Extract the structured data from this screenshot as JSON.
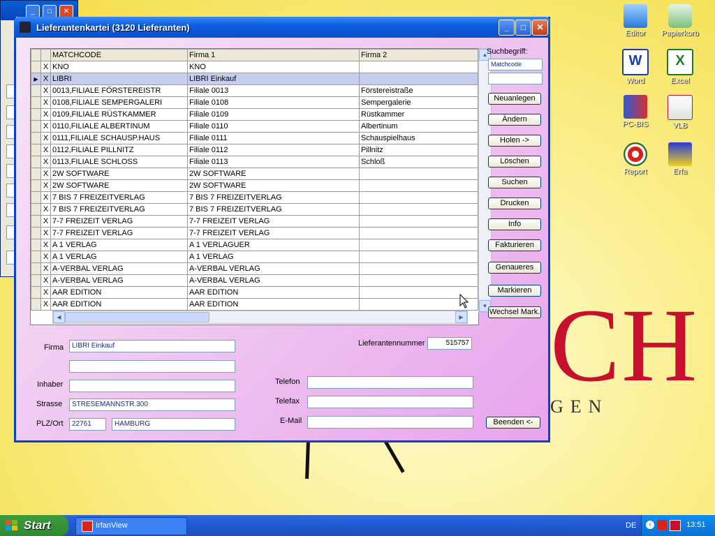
{
  "window": {
    "title": "Lieferantenkartei (3120 Lieferanten)"
  },
  "grid": {
    "columns": [
      "MATCHCODE",
      "Firma 1",
      "Firma 2"
    ],
    "rows": [
      {
        "check": "X",
        "matchcode": "KNO",
        "firma1": "KNO",
        "firma2": ""
      },
      {
        "check": "X",
        "matchcode": "LIBRI",
        "firma1": "LIBRI Einkauf",
        "firma2": ""
      },
      {
        "check": "X",
        "matchcode": "0013,FILIALE FÖRSTEREISTR",
        "firma1": "Filiale 0013",
        "firma2": "Förstereistraße"
      },
      {
        "check": "X",
        "matchcode": "0108,FILIALE SEMPERGALERI",
        "firma1": "Filiale 0108",
        "firma2": "Sempergalerie"
      },
      {
        "check": "X",
        "matchcode": "0109,FILIALE RÜSTKAMMER",
        "firma1": "Filiale 0109",
        "firma2": "Rüstkammer"
      },
      {
        "check": "X",
        "matchcode": "0110,FILIALE ALBERTINUM",
        "firma1": "Filiale 0110",
        "firma2": "Albertinum"
      },
      {
        "check": "X",
        "matchcode": "0111,FILIALE SCHAUSP.HAUS",
        "firma1": "Filiale 0111",
        "firma2": "Schauspielhaus"
      },
      {
        "check": "X",
        "matchcode": "0112,FILIALE PILLNITZ",
        "firma1": "Filiale 0112",
        "firma2": "Pillnitz"
      },
      {
        "check": "X",
        "matchcode": "0113,FILIALE SCHLOSS",
        "firma1": "Filiale 0113",
        "firma2": "Schloß"
      },
      {
        "check": "X",
        "matchcode": "2W SOFTWARE",
        "firma1": "2W SOFTWARE",
        "firma2": ""
      },
      {
        "check": "X",
        "matchcode": "2W SOFTWARE",
        "firma1": "2W SOFTWARE",
        "firma2": ""
      },
      {
        "check": "X",
        "matchcode": "7 BIS 7 FREIZEITVERLAG",
        "firma1": "7 BIS 7 FREIZEITVERLAG",
        "firma2": ""
      },
      {
        "check": "X",
        "matchcode": "7 BIS 7 FREIZEITVERLAG",
        "firma1": "7 BIS 7 FREIZEITVERLAG",
        "firma2": ""
      },
      {
        "check": "X",
        "matchcode": "7-7 FREIZEIT VERLAG",
        "firma1": "7-7 FREIZEIT VERLAG",
        "firma2": ""
      },
      {
        "check": "X",
        "matchcode": "7-7 FREIZEIT VERLAG",
        "firma1": "7-7 FREIZEIT VERLAG",
        "firma2": ""
      },
      {
        "check": "X",
        "matchcode": "A 1 VERLAG",
        "firma1": "A 1 VERLAGUER",
        "firma2": ""
      },
      {
        "check": "X",
        "matchcode": "A 1 VERLAG",
        "firma1": "A 1 VERLAG",
        "firma2": ""
      },
      {
        "check": "X",
        "matchcode": "A-VERBAL VERLAG",
        "firma1": "A-VERBAL VERLAG",
        "firma2": ""
      },
      {
        "check": "X",
        "matchcode": "A-VERBAL VERLAG",
        "firma1": "A-VERBAL VERLAG",
        "firma2": ""
      },
      {
        "check": "X",
        "matchcode": "AAR EDITION",
        "firma1": "AAR EDITION",
        "firma2": ""
      },
      {
        "check": "X",
        "matchcode": "AAR EDITION",
        "firma1": "AAR EDITION",
        "firma2": ""
      }
    ],
    "selected_row": 1
  },
  "search": {
    "label": "Suchbegriff:",
    "field_value": "Matchcode",
    "input_value": ""
  },
  "buttons": {
    "neuanlegen": "Neuanlegen",
    "aendern": "Ändern",
    "holen": "Holen ->",
    "loeschen": "Löschen",
    "suchen": "Suchen",
    "drucken": "Drucken",
    "info": "Info",
    "fakturieren": "Fakturieren",
    "genaueres": "Genaueres",
    "markieren": "Markieren",
    "wechsel": "Wechsel Mark.",
    "beenden": "Beenden <-"
  },
  "form": {
    "firma_label": "Firma",
    "firma": "LIBRI Einkauf",
    "firma2": "",
    "inhaber_label": "Inhaber",
    "inhaber": "",
    "strasse_label": "Strasse",
    "strasse": "STRESEMANNSTR.300",
    "plzort_label": "PLZ/Ort",
    "plz": "22761",
    "ort": "HAMBURG",
    "liefnr_label": "Lieferantennummer",
    "liefnr": "515757",
    "telefon_label": "Telefon",
    "telefon": "",
    "telefax_label": "Telefax",
    "telefax": "",
    "email_label": "E-Mail",
    "email": ""
  },
  "desktop": {
    "icons": [
      {
        "label": "Editor",
        "icon": "notepad-icon"
      },
      {
        "label": "Papierkorb",
        "icon": "recycle-bin-icon"
      },
      {
        "label": "Word",
        "icon": "word-icon"
      },
      {
        "label": "Excel",
        "icon": "excel-icon"
      },
      {
        "label": "PC-BIS",
        "icon": "pcbis-icon"
      },
      {
        "label": "VLB",
        "icon": "vlb-icon"
      },
      {
        "label": "Report",
        "icon": "report-icon"
      },
      {
        "label": "Erfa",
        "icon": "erfa-icon"
      }
    ],
    "wallpaper_letters": "CH",
    "wallpaper_sub": "GEN"
  },
  "taskbar": {
    "start": "Start",
    "task_item": "IrfanView",
    "lang": "DE",
    "clock": "13:51"
  }
}
